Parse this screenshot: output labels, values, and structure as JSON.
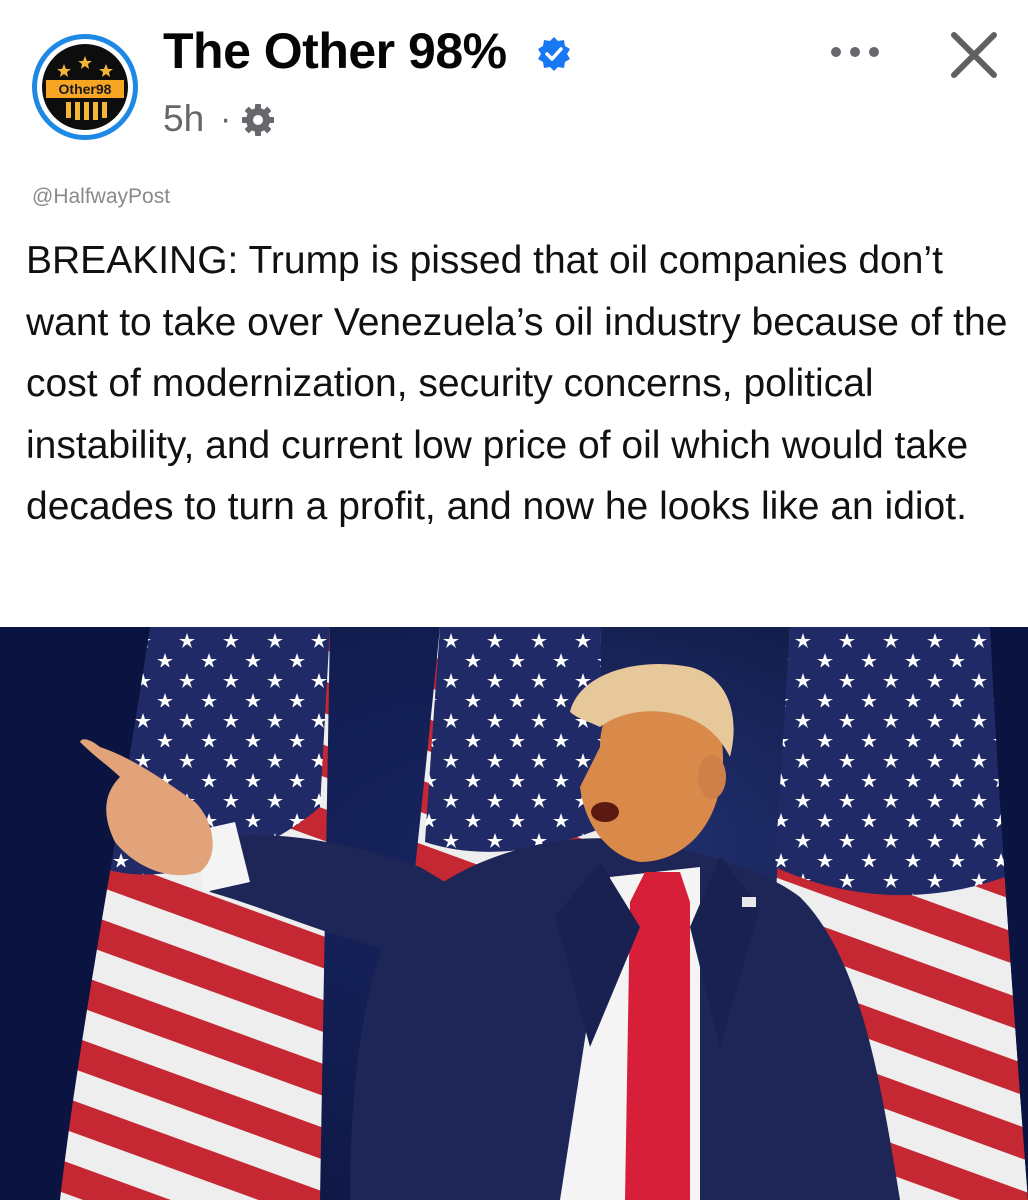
{
  "post": {
    "author": "The Other 98%",
    "avatar_text": "Other98",
    "time": "5h",
    "separator": "·",
    "audience": "gear-icon",
    "verified": true
  },
  "actions": {
    "more_icon": "more-horizontal-icon",
    "close_icon": "close-icon"
  },
  "tweet": {
    "handle": "@HalfwayPost",
    "text": "BREAKING:  Trump is pissed that oil companies don’t want to take over Venezuela’s oil industry because of the cost of modernization, security concerns, political instability, and current low price of oil which would take decades to turn a profit, and now he looks like an idiot."
  },
  "colors": {
    "brand_blue": "#1e88e5",
    "text_primary": "#050505",
    "text_secondary": "#65676b",
    "flag_red": "#c62833",
    "flag_blue": "#1f2a66",
    "tie_red": "#d81f3a"
  }
}
